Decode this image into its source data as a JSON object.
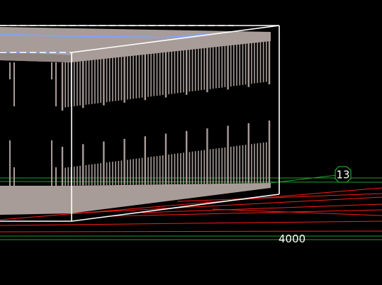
{
  "viewport": {
    "background": "#000000",
    "colors": {
      "model": "#a89c98",
      "selection_box": "#ffffff",
      "red_lines": "#ff1a1a",
      "green_lines": "#1f9e2a",
      "blue_edge": "#7aa6ff",
      "label_text": "#ffffff"
    }
  },
  "marker": {
    "shape": "hexagon",
    "label": "13"
  },
  "dimension_label": "4000"
}
